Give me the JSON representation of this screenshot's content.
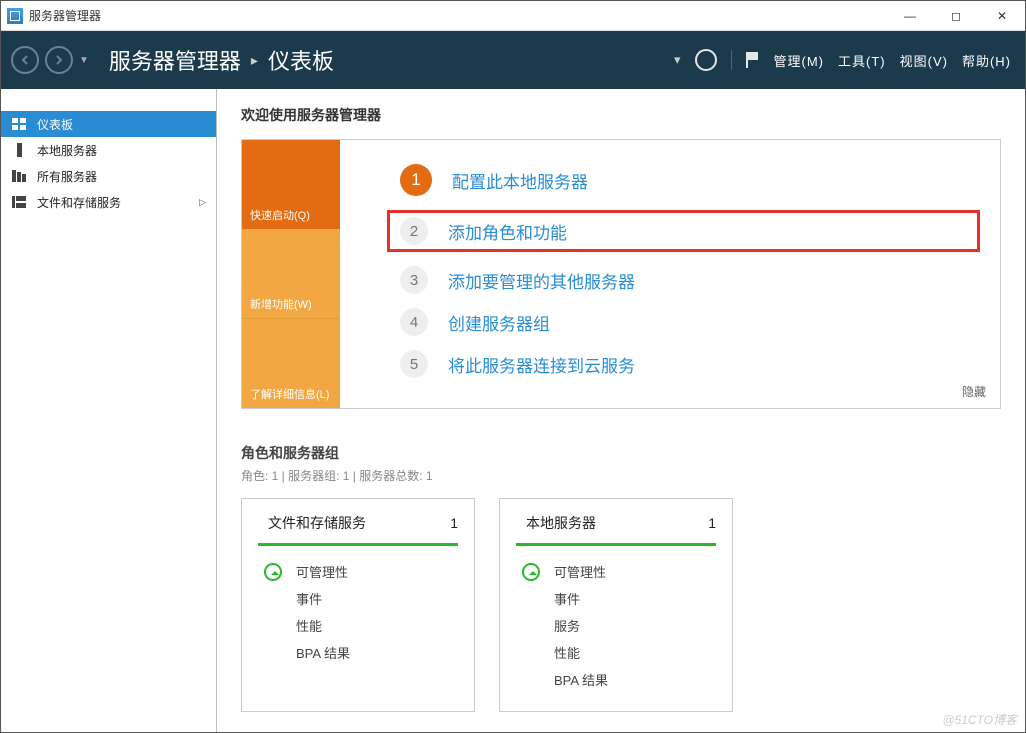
{
  "titlebar": {
    "title": "服务器管理器"
  },
  "header": {
    "breadcrumb": {
      "root": "服务器管理器",
      "current": "仪表板"
    },
    "menu": {
      "manage": "管理(M)",
      "tools": "工具(T)",
      "view": "视图(V)",
      "help": "帮助(H)"
    },
    "dropdown_caret": "▾"
  },
  "sidebar": {
    "items": [
      {
        "label": "仪表板"
      },
      {
        "label": "本地服务器"
      },
      {
        "label": "所有服务器"
      },
      {
        "label": "文件和存储服务",
        "expandable": true
      }
    ]
  },
  "main": {
    "welcome_title": "欢迎使用服务器管理器",
    "left_tabs": {
      "quick": "快速启动(Q)",
      "new": "新增功能(W)",
      "learn": "了解详细信息(L)"
    },
    "steps": [
      {
        "num": "1",
        "label": "配置此本地服务器"
      },
      {
        "num": "2",
        "label": "添加角色和功能"
      },
      {
        "num": "3",
        "label": "添加要管理的其他服务器"
      },
      {
        "num": "4",
        "label": "创建服务器组"
      },
      {
        "num": "5",
        "label": "将此服务器连接到云服务"
      }
    ],
    "hide": "隐藏",
    "groups_title": "角色和服务器组",
    "groups_sub": "角色: 1 | 服务器组: 1 | 服务器总数: 1",
    "tiles": [
      {
        "title": "文件和存储服务",
        "count": "1",
        "rows": [
          "可管理性",
          "事件",
          "性能",
          "BPA 结果"
        ],
        "icon": "storage"
      },
      {
        "title": "本地服务器",
        "count": "1",
        "rows": [
          "可管理性",
          "事件",
          "服务",
          "性能",
          "BPA 结果"
        ],
        "icon": "server"
      }
    ]
  },
  "watermark": "@51CTO博客"
}
